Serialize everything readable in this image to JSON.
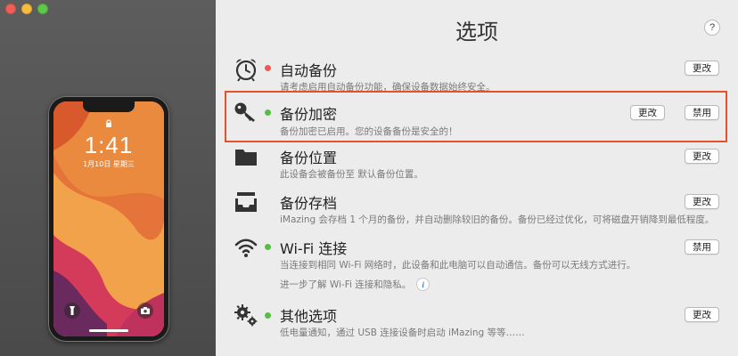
{
  "window": {
    "title": "选项"
  },
  "help": {
    "label": "?"
  },
  "phone": {
    "time": "1:41",
    "date": "1月10日 星期三"
  },
  "rows": [
    {
      "title": "自动备份",
      "desc": "请考虑启用自动备份功能，确保设备数据始终安全。",
      "status": "red",
      "icon": "alarm-clock-icon",
      "buttons": [
        "更改"
      ]
    },
    {
      "title": "备份加密",
      "desc": "备份加密已启用。您的设备备份是安全的！",
      "status": "green",
      "icon": "key-icon",
      "buttons": [
        "更改",
        "禁用"
      ]
    },
    {
      "title": "备份位置",
      "desc": "此设备会被备份至 默认备份位置。",
      "status": "none",
      "icon": "folder-icon",
      "buttons": [
        "更改"
      ]
    },
    {
      "title": "备份存档",
      "desc": "iMazing 会存档 1 个月的备份，并自动删除较旧的备份。备份已经过优化，可将磁盘开销降到最低程度。",
      "status": "none",
      "icon": "archive-tray-icon",
      "buttons": [
        "更改"
      ]
    },
    {
      "title": "Wi-Fi 连接",
      "desc": "当连接到相同 Wi-Fi 网络时，此设备和此电脑可以自动通信。备份可以无线方式进行。",
      "desc2": "进一步了解 Wi-Fi 连接和隐私。",
      "status": "green",
      "icon": "wifi-icon",
      "buttons": [
        "禁用"
      ]
    },
    {
      "title": "其他选项",
      "desc": "低电量通知，通过 USB 连接设备时启动 iMazing 等等……",
      "status": "green",
      "icon": "gears-icon",
      "buttons": [
        "更改"
      ]
    }
  ],
  "colors": {
    "highlight": "#e5522a",
    "status_red": "#ec5a4f",
    "status_green": "#54c13e"
  }
}
